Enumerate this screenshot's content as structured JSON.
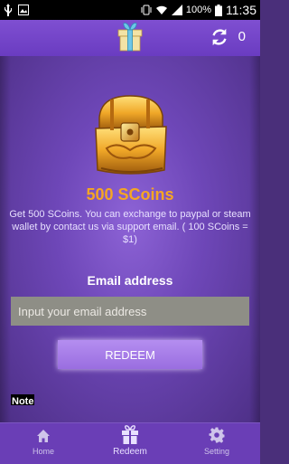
{
  "status_bar": {
    "battery": "100%",
    "time": "11:35",
    "icons": [
      "usb-icon",
      "image-icon",
      "vibrate-icon",
      "wifi-icon",
      "signal-icon",
      "battery-icon"
    ]
  },
  "header": {
    "coin_count": "0",
    "icons": [
      "gift-icon",
      "refresh-icon"
    ]
  },
  "offer": {
    "title": "500 SCoins",
    "description": "Get 500 SCoins. You can exchange to paypal or steam wallet by contact us via support email. ( 100 SCoins = $1)",
    "image": "treasure-chest-icon"
  },
  "form": {
    "email_label": "Email address",
    "email_placeholder": "Input your email address",
    "email_value": "",
    "redeem_label": "REDEEM",
    "note_label": "Note"
  },
  "bottom_nav": {
    "items": [
      {
        "label": "Home",
        "icon": "home-icon"
      },
      {
        "label": "Redeem",
        "icon": "gift-icon",
        "active": true
      },
      {
        "label": "Setting",
        "icon": "gear-icon"
      }
    ]
  },
  "colors": {
    "accent": "#f5a623",
    "header_bg": "#6a3cc1",
    "button_bg": "#9a6ee0",
    "nav_bg": "#6a3eb6"
  }
}
